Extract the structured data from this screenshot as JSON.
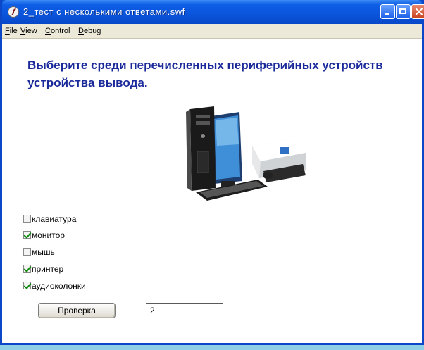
{
  "window": {
    "title": "2_тест с несколькими ответами.swf"
  },
  "menu": {
    "items": [
      {
        "first": "F",
        "rest": "ile"
      },
      {
        "first": "V",
        "rest": "iew"
      },
      {
        "first": "C",
        "rest": "ontrol"
      },
      {
        "first": "D",
        "rest": "ebug"
      }
    ]
  },
  "question": {
    "line1": "Выберите среди перечисленных периферийных устройств",
    "line2": "устройства вывода."
  },
  "options": [
    {
      "label": "клавиатура",
      "checked": false
    },
    {
      "label": "монитор",
      "checked": true
    },
    {
      "label": "мышь",
      "checked": false
    },
    {
      "label": "принтер",
      "checked": true
    },
    {
      "label": "аудиоколонки",
      "checked": true
    }
  ],
  "actions": {
    "check_label": "Проверка",
    "answer_value": "2"
  },
  "colors": {
    "title_bar": "#0a55dc",
    "question_text": "#1b2a9a",
    "check_mark": "#0c8a0c"
  }
}
